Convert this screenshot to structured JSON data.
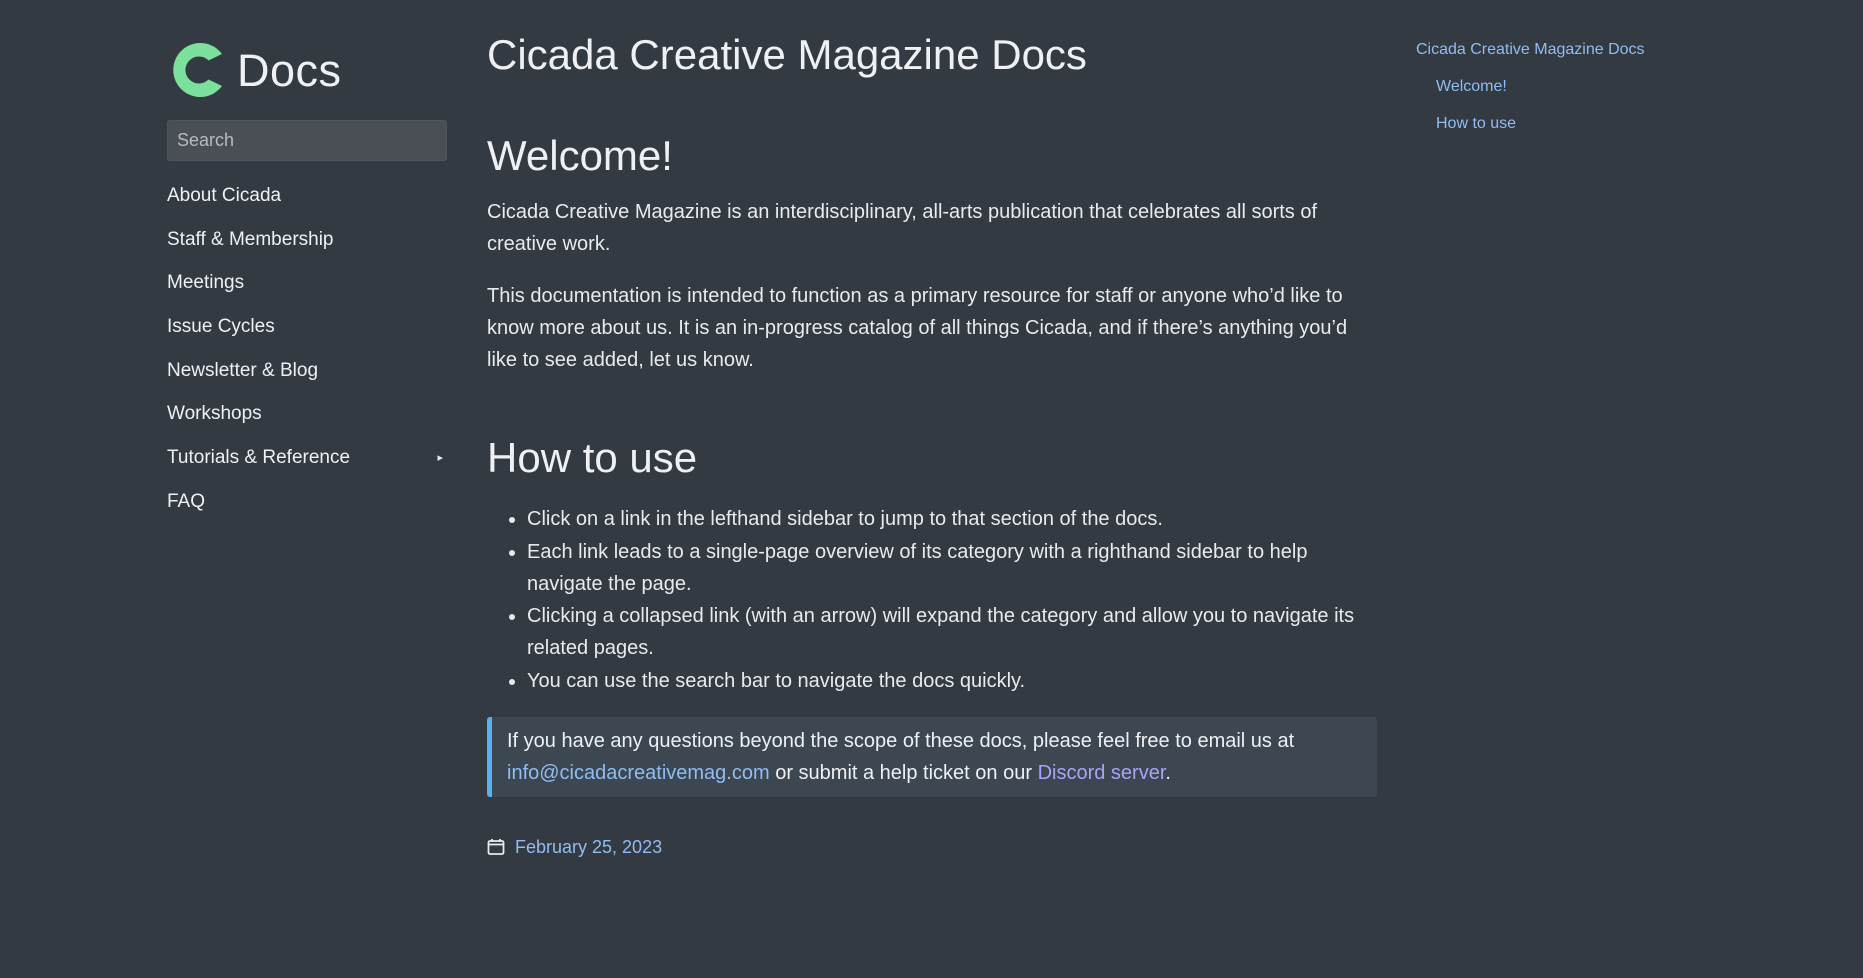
{
  "brand": {
    "logo_color": "#7be09c",
    "title": "Docs"
  },
  "search": {
    "placeholder": "Search",
    "value": ""
  },
  "sidebar": {
    "items": [
      {
        "label": "About Cicada"
      },
      {
        "label": "Staff & Membership"
      },
      {
        "label": "Meetings"
      },
      {
        "label": "Issue Cycles"
      },
      {
        "label": "Newsletter & Blog"
      },
      {
        "label": "Workshops"
      },
      {
        "label": "Tutorials & Reference",
        "caret": "▸"
      },
      {
        "label": "FAQ"
      }
    ]
  },
  "main": {
    "title": "Cicada Creative Magazine Docs",
    "welcome": {
      "heading": "Welcome!",
      "p1": "Cicada Creative Magazine is an interdisciplinary, all-arts publication that celebrates all sorts of creative work.",
      "p2": "This documentation is intended to function as a primary resource for staff or anyone who’d like to know more about us. It is an in-progress catalog of all things Cicada, and if there’s anything you’d like to see added, let us know."
    },
    "how_to_use": {
      "heading": "How to use",
      "items": [
        "Click on a link in the lefthand sidebar to jump to that section of the docs.",
        "Each link leads to a single-page overview of its category with a righthand sidebar to help navigate the page.",
        "Clicking a collapsed link (with an arrow) will expand the category and allow you to navigate its related pages.",
        "You can use the search bar to navigate the docs quickly."
      ]
    },
    "callout": {
      "text_before": "If you have any questions beyond the scope of these docs, please feel free to email us at ",
      "email": "info@cicadacreativemag.com",
      "text_middle": " or submit a help ticket on our ",
      "discord_link": "Discord server",
      "text_after": "."
    },
    "date": {
      "icon": "calendar-icon",
      "text": "February 25, 2023"
    }
  },
  "toc": {
    "title": "Cicada Creative Magazine Docs",
    "items": [
      "Welcome!",
      "How to use"
    ]
  },
  "colors": {
    "background": "#343a42",
    "link": "#8fbdf2",
    "discord_link": "#a9a3f6",
    "callout_border": "#59b0ee",
    "callout_bg": "#3c4752",
    "logo": "#7be09c"
  }
}
